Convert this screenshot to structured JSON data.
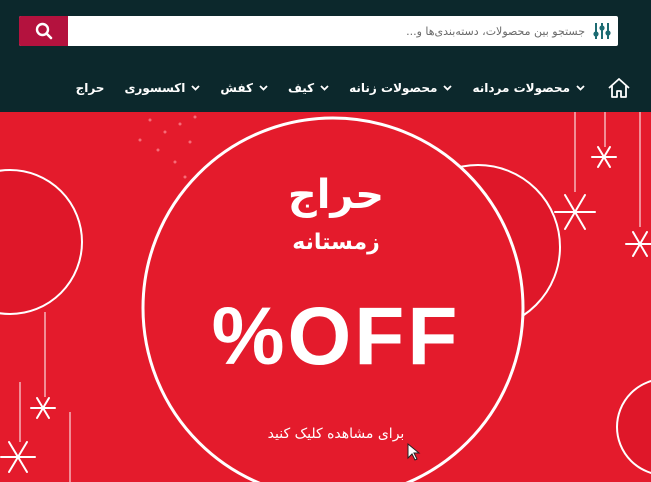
{
  "search": {
    "placeholder": "جستجو بین محصولات، دسته‌بندی‌ها و...",
    "value": ""
  },
  "icons": {
    "search": "search-icon",
    "filter": "sliders-icon",
    "home": "home-icon",
    "dropdown": "chevron-down-icon"
  },
  "nav": {
    "items": [
      {
        "label": "محصولات مردانه",
        "has_dropdown": true
      },
      {
        "label": "محصولات زنانه",
        "has_dropdown": true
      },
      {
        "label": "کیف",
        "has_dropdown": true
      },
      {
        "label": "کفش",
        "has_dropdown": true
      },
      {
        "label": "اکسسوری",
        "has_dropdown": true
      },
      {
        "label": "حراج",
        "has_dropdown": false
      }
    ]
  },
  "banner": {
    "title": "حراج",
    "subtitle": "زمستانه",
    "off_text": "%OFF",
    "cta": "برای مشاهده کلیک کنید"
  },
  "colors": {
    "header_bg": "#0c282c",
    "accent": "#b4123e",
    "banner_bg": "#e41b2c",
    "text": "#ffffff"
  }
}
